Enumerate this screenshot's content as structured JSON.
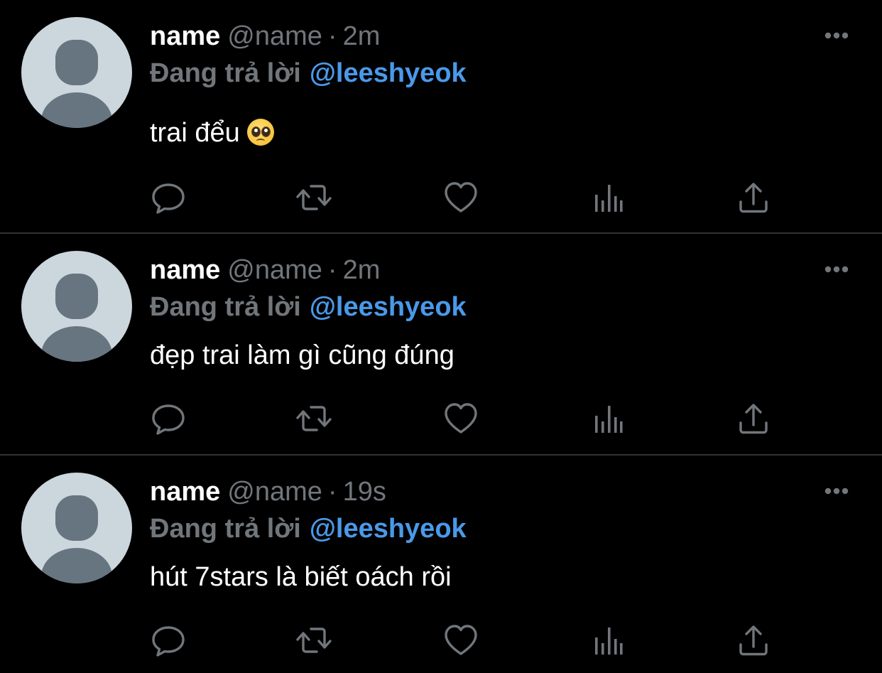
{
  "colors": {
    "background": "#000000",
    "divider": "#2f3336",
    "secondary_text": "#71767b",
    "mention": "#4a99e9",
    "primary_text": "#ffffff",
    "avatar_bg": "#ccd6dd",
    "avatar_fg": "#66757f"
  },
  "icons": {
    "reply": "speech-bubble-icon",
    "retweet": "retweet-icon",
    "like": "heart-icon",
    "views": "bar-chart-icon",
    "share": "share-upload-icon",
    "more": "more-dots-icon"
  },
  "tweets": [
    {
      "name": "name",
      "handle": "@name",
      "separator": "·",
      "time": "2m",
      "replying_label": "Đang trả lời",
      "replying_to": "@leeshyeok",
      "text": "trai đểu",
      "emoji": "pleading-face-emoji"
    },
    {
      "name": "name",
      "handle": "@name",
      "separator": "·",
      "time": "2m",
      "replying_label": "Đang trả lời",
      "replying_to": "@leeshyeok",
      "text": "đẹp trai làm gì cũng đúng"
    },
    {
      "name": "name",
      "handle": "@name",
      "separator": "·",
      "time": "19s",
      "replying_label": "Đang trả lời",
      "replying_to": "@leeshyeok",
      "text": "hút 7stars là biết oách rồi"
    }
  ]
}
